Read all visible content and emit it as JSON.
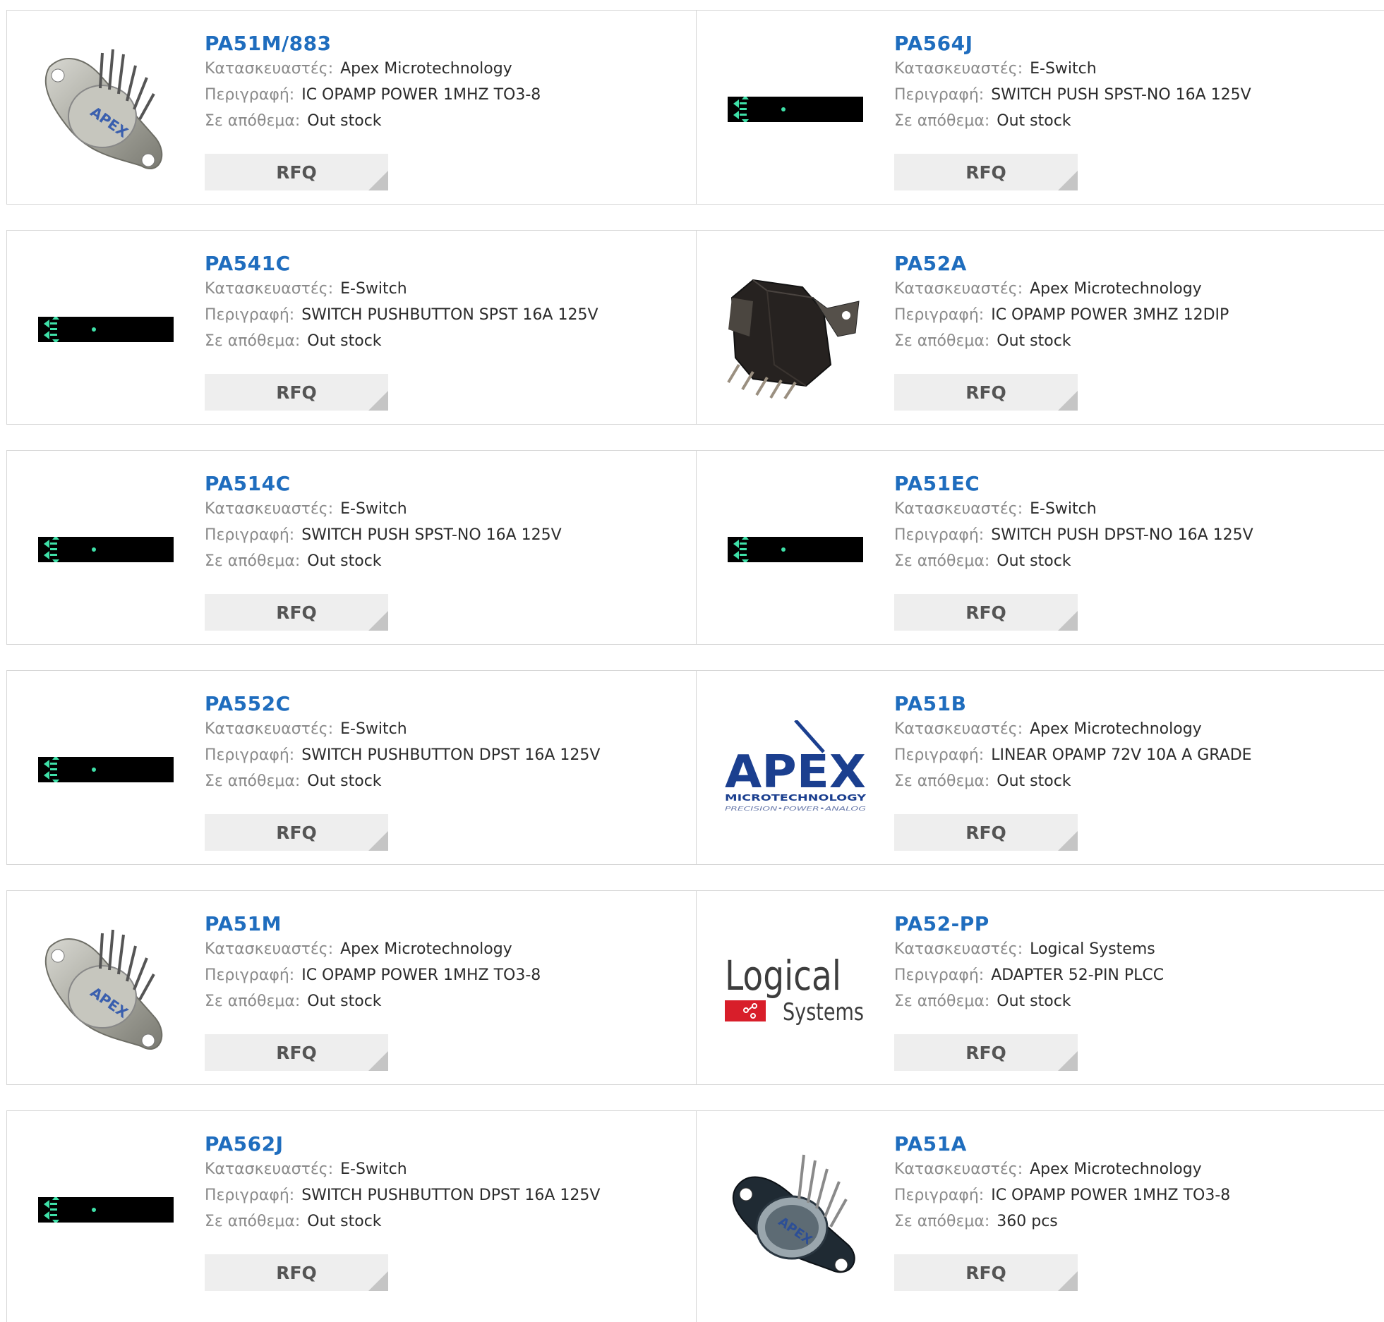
{
  "labels": {
    "manufacturer": "Κατασκευαστές:",
    "description": "Περιγραφή:",
    "stock": "Σε απόθεμα:",
    "rfq": "RFQ"
  },
  "products": [
    {
      "part": "PA51M/883",
      "manufacturer": "Apex Microtechnology",
      "description": "IC OPAMP POWER 1MHZ TO3-8",
      "stock": "Out stock",
      "image": "to3-package-apex"
    },
    {
      "part": "PA564J",
      "manufacturer": "E-Switch",
      "description": "SWITCH PUSH SPST-NO 16A 125V",
      "stock": "Out stock",
      "image": "eswitch-placeholder"
    },
    {
      "part": "PA541C",
      "manufacturer": "E-Switch",
      "description": "SWITCH PUSHBUTTON SPST 16A 125V",
      "stock": "Out stock",
      "image": "eswitch-placeholder"
    },
    {
      "part": "PA52A",
      "manufacturer": "Apex Microtechnology",
      "description": "IC OPAMP POWER 3MHZ 12DIP",
      "stock": "Out stock",
      "image": "dip-module"
    },
    {
      "part": "PA514C",
      "manufacturer": "E-Switch",
      "description": "SWITCH PUSH SPST-NO 16A 125V",
      "stock": "Out stock",
      "image": "eswitch-placeholder"
    },
    {
      "part": "PA51EC",
      "manufacturer": "E-Switch",
      "description": "SWITCH PUSH DPST-NO 16A 125V",
      "stock": "Out stock",
      "image": "eswitch-placeholder"
    },
    {
      "part": "PA552C",
      "manufacturer": "E-Switch",
      "description": "SWITCH PUSHBUTTON DPST 16A 125V",
      "stock": "Out stock",
      "image": "eswitch-placeholder"
    },
    {
      "part": "PA51B",
      "manufacturer": "Apex Microtechnology",
      "description": "LINEAR OPAMP 72V 10A A GRADE",
      "stock": "Out stock",
      "image": "apex-logo"
    },
    {
      "part": "PA51M",
      "manufacturer": "Apex Microtechnology",
      "description": "IC OPAMP POWER 1MHZ TO3-8",
      "stock": "Out stock",
      "image": "to3-package-apex"
    },
    {
      "part": "PA52-PP",
      "manufacturer": "Logical Systems",
      "description": "ADAPTER 52-PIN PLCC",
      "stock": "Out stock",
      "image": "logical-systems-logo"
    },
    {
      "part": "PA562J",
      "manufacturer": "E-Switch",
      "description": "SWITCH PUSHBUTTON DPST 16A 125V",
      "stock": "Out stock",
      "image": "eswitch-placeholder"
    },
    {
      "part": "PA51A",
      "manufacturer": "Apex Microtechnology",
      "description": "IC OPAMP POWER 1MHZ TO3-8",
      "stock": "360 pcs",
      "image": "to3-package-dark"
    }
  ],
  "logos": {
    "apex_main": "APEX",
    "apex_sub": "MICROTECHNOLOGY",
    "apex_tag": "PRECISION•POWER•ANALOG",
    "logical_main": "Logical",
    "logical_sub": "Systems"
  },
  "colors": {
    "part_link": "#1f6dbe",
    "label": "#8a8a8a",
    "value": "#2b2b2b",
    "rfq_bg": "#eeeeee",
    "border": "#d6d6d6",
    "apex_blue": "#1b3f8f",
    "logical_red": "#d81e2a"
  }
}
